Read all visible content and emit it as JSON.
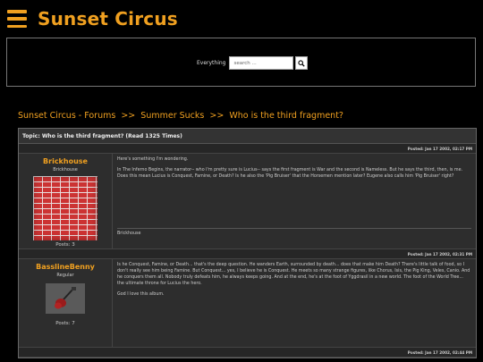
{
  "site": {
    "title": "Sunset Circus"
  },
  "search": {
    "scope": "Everything",
    "placeholder": "search ..."
  },
  "breadcrumb": {
    "items": [
      "Sunset Circus - Forums",
      "Summer Sucks",
      "Who is the third fragment?"
    ],
    "separator": ">>"
  },
  "topic": {
    "title": "Topic: Who is the third fragment? (Read 1325 Times)"
  },
  "posts": [
    {
      "date": "Posted: Jan 17 2002, 02:17 PM",
      "author": "Brickhouse",
      "rank": "Brickhouse",
      "post_count": "Posts: 3",
      "paragraphs": [
        "Here's something I'm wondering.",
        "In The Inferno Begins, the narrator-- who I'm pretty sure is Lucius-- says the first fragment is War and the second is Nameless. But he says the third, then, is me. Does this mean Lucius is Conquest, Famine, or Death? Is he also the 'Pig Bruiser' that the Horsemen mention later? Eugene also calls him 'Pig Bruiser' right?"
      ],
      "signature": "Brickhouse"
    },
    {
      "date": "Posted: Jan 17 2002, 02:31 PM",
      "author": "BasslineBenny",
      "rank": "Regular",
      "post_count": "Posts: 7",
      "paragraphs": [
        "Is he Conquest, Famine, or Death... that's the deep question. He wanders Earth, surrounded by death... does that make him Death? There's little talk of food, so I don't really see him being Famine. But Conquest... yes, I believe he is Conquest. He meets so many strange figures, like Chorus, Isis, the Pig King, Veles, Canio. And he conquers them all. Nobody truly defeats him, he always keeps going. And at the end, he's at the foot of Yggdrasil in a new world. The foot of the World Tree... the ultimate throne for Lucius the hero.",
        "God I love this album."
      ]
    },
    {
      "date": "Posted: Jan 17 2002, 02:44 PM"
    }
  ],
  "colors": {
    "accent": "#f0a020",
    "background": "#000000",
    "panel": "#2d2d2d"
  }
}
